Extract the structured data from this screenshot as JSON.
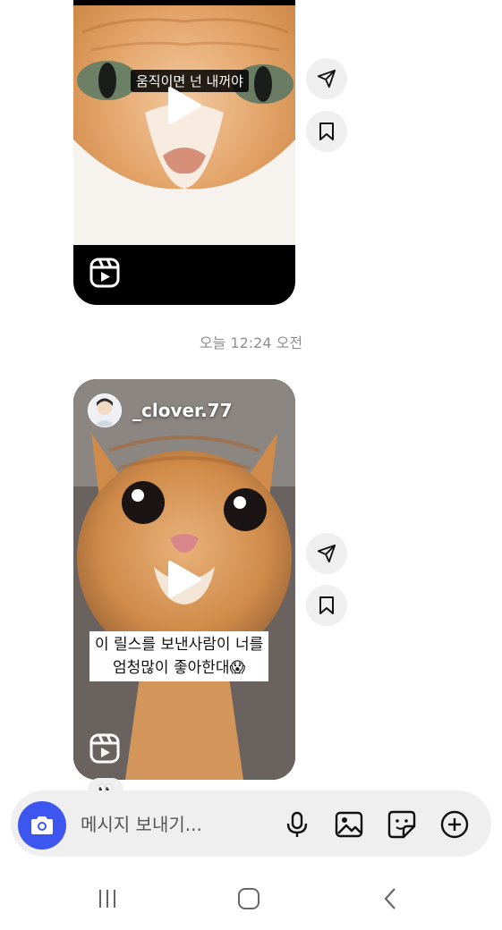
{
  "messages": [
    {
      "caption": "움직이면 넌 내꺼야",
      "play_icon": "play-icon",
      "badge_icon": "reels-icon"
    },
    {
      "author": "_clover.77",
      "caption_line1": "이 릴스를 보낸사람이 너를",
      "caption_line2": "엄청많이 좋아한대😱",
      "play_icon": "play-icon",
      "badge_icon": "reels-icon"
    }
  ],
  "timestamp": "오늘 12:24 오전",
  "reaction": "👀",
  "composer": {
    "placeholder": "메시지 보내기...",
    "icons": [
      "camera-icon",
      "microphone-icon",
      "gallery-icon",
      "sticker-icon",
      "plus-circle-icon"
    ],
    "accent": "#3e56f0"
  },
  "side_actions": [
    "share-icon",
    "save-icon"
  ],
  "navbar": [
    "recent-apps-icon",
    "home-icon",
    "back-icon"
  ]
}
